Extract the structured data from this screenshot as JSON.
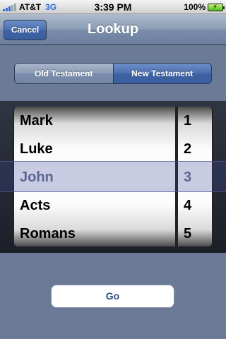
{
  "status_bar": {
    "carrier": "AT&T",
    "network": "3G",
    "time": "3:39 PM",
    "battery": "100%"
  },
  "nav": {
    "cancel_label": "Cancel",
    "title": "Lookup"
  },
  "segmented": {
    "options": [
      "Old Testament",
      "New Testament"
    ],
    "selected": "New Testament"
  },
  "picker": {
    "books": [
      "Mark",
      "Luke",
      "John",
      "Acts",
      "Romans"
    ],
    "chapters": [
      "1",
      "2",
      "3",
      "4",
      "5"
    ],
    "selected_book": "John",
    "selected_chapter": "3"
  },
  "go_label": "Go",
  "colors": {
    "nav_blue": "#3d62a4",
    "background": "#6b7a96",
    "go_text": "#2f4b7c"
  }
}
